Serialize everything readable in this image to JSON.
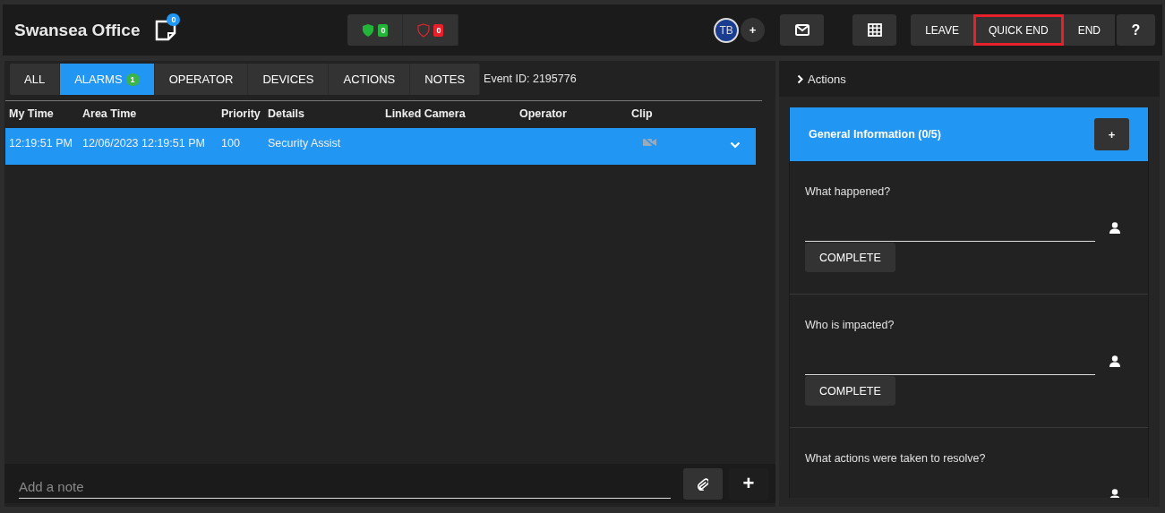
{
  "header": {
    "title": "Swansea Office",
    "notes_count": "0",
    "status_counts": [
      {
        "kind": "ok",
        "count": "0"
      },
      {
        "kind": "alert",
        "count": "0"
      }
    ],
    "operator_initials": "TB",
    "add_operator": "+",
    "buttons": [
      {
        "label": "LEAVE",
        "highlighted": false
      },
      {
        "label": "QUICK END",
        "highlighted": true
      },
      {
        "label": "END",
        "highlighted": false
      },
      {
        "label": "?",
        "highlighted": false
      }
    ]
  },
  "tabs": [
    {
      "label": "ALL",
      "selected": false
    },
    {
      "label": "ALARMS",
      "badge": "1",
      "selected": true
    },
    {
      "label": "OPERATOR",
      "selected": false
    },
    {
      "label": "DEVICES",
      "selected": false
    },
    {
      "label": "ACTIONS",
      "selected": false
    },
    {
      "label": "NOTES",
      "selected": false
    }
  ],
  "event_id": "Event ID: 2195776",
  "table": {
    "columns": [
      "My Time",
      "Area Time",
      "Priority",
      "Details",
      "Linked Camera",
      "Operator",
      "Clip"
    ],
    "rows": [
      {
        "cells": [
          "12:19:51 PM",
          "12/06/2023 12:19:51 PM",
          "100",
          "Security Assist"
        ],
        "selected": true
      }
    ]
  },
  "note": {
    "placeholder": "Add a note",
    "add": "+"
  },
  "actions_panel": {
    "title": "Actions",
    "section": {
      "title": "General Information (0/5)",
      "add": "+",
      "questions": [
        {
          "label": "What happened?",
          "button": "COMPLETE"
        },
        {
          "label": "Who is impacted?",
          "button": "COMPLETE"
        },
        {
          "label": "What actions were taken to resolve?"
        }
      ]
    }
  }
}
